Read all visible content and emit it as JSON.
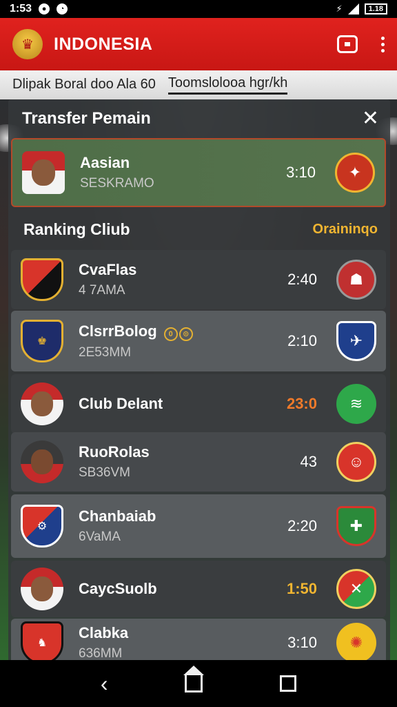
{
  "status_bar": {
    "time": "1:53",
    "battery": "1.18",
    "icons": [
      "notification-icon",
      "clock-icon",
      "wifi-icon",
      "signal-icon",
      "battery-icon"
    ]
  },
  "app_bar": {
    "title": "INDONESIA",
    "icons": [
      "crest-icon",
      "cast-icon",
      "more-vert-icon"
    ]
  },
  "tabs": [
    {
      "label": "Dlipak Boral doo  Ala 60"
    },
    {
      "label": "Toomslolooa hgr/kh"
    }
  ],
  "panel": {
    "title": "Transfer Pemain",
    "featured": {
      "name": "Aasian",
      "sub": "SESKRAMO",
      "time": "3:10"
    },
    "section": {
      "title": "Ranking Cliub",
      "link": "Oraininqo"
    },
    "rows": [
      {
        "name": "CvaFlas",
        "sub": "4 7AMA",
        "time": "2:40",
        "time_color": "#ffffff"
      },
      {
        "name": "ClsrrBolog",
        "sub": "2E53MM",
        "time": "2:10",
        "time_color": "#ffffff"
      },
      {
        "name": "Club Delant",
        "sub": "",
        "time": "23:0",
        "time_color": "#f07a2a"
      },
      {
        "name": "RuoRolas",
        "sub": "SB36VM",
        "time": "43",
        "time_color": "#ffffff"
      },
      {
        "name": "Chanbaiab",
        "sub": "6VaMA",
        "time": "2:20",
        "time_color": "#ffffff"
      },
      {
        "name": "CaycSuolb",
        "sub": "",
        "time": "1:50",
        "time_color": "#f0b531"
      },
      {
        "name": "Clabka",
        "sub": "636MM",
        "time": "3:10",
        "time_color": "#ffffff"
      }
    ]
  },
  "colors": {
    "accent": "#e0221e",
    "highlight": "#f0b531"
  }
}
